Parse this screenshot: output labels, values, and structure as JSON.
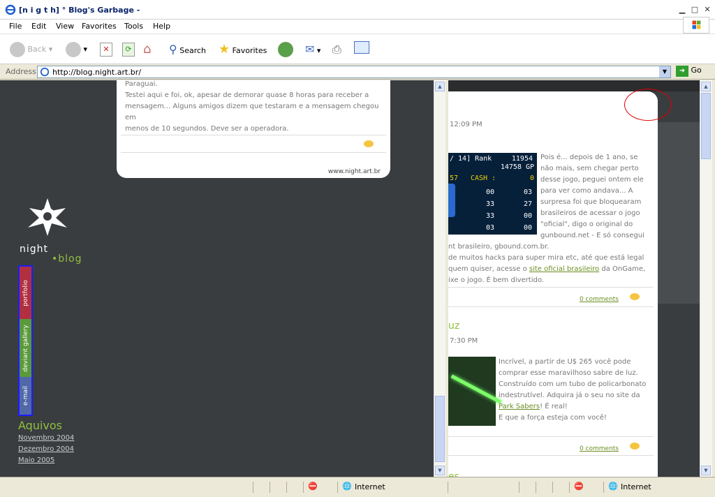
{
  "window": {
    "title": "[n i g t h] ° Blog's Garbage -"
  },
  "menu": [
    "File",
    "Edit",
    "View",
    "Favorites",
    "Tools",
    "Help"
  ],
  "toolbar": {
    "back": "Back",
    "search": "Search",
    "favorites": "Favorites"
  },
  "address": {
    "label": "Address",
    "url": "http://blog.night.art.br/",
    "go": "Go"
  },
  "left": {
    "post_text": [
      "Paraguai.",
      "Testei aqui e foi, ok, apesar de demorar quase 8 horas para receber a",
      "mensagem... Alguns amigos dizem que testaram e a mensagem chegou em",
      "menos de 10 segundos. Deve ser a operadora."
    ],
    "footer_url": "www.night.art.br",
    "logo_top": "night",
    "logo_bottom": "blog",
    "nav": [
      "portfolio",
      "deviant gallery",
      "e-mail"
    ],
    "archives_title": "Aquivos",
    "archives": [
      "Novembro 2004",
      "Dezembro 2004",
      "Maio 2005"
    ]
  },
  "right": {
    "post1_time": "12:09 PM",
    "game": {
      "rank_label": "/ 14]  Rank",
      "rank": "11954",
      "gp": "14758 GP",
      "cash_prefix": "57",
      "cash_label": "CASH :",
      "cash": "0",
      "stats": [
        "00",
        "03",
        "33",
        "27",
        "33",
        "00",
        "03",
        "00"
      ]
    },
    "post1_lines": [
      "Pois é... depois de 1 ano, se",
      "não mais, sem chegar perto",
      "desse jogo, peguei ontem ele",
      "para ver como andava... A",
      "surpresa foi que bloquearam",
      "brasileiros de acessar o jogo",
      "\"oficial\", digo o original do",
      "gunbound.net - E só consegui",
      "nt brasileiro, gbound.com.br.",
      "de muitos hacks para super mira etc, até que está legal",
      "quem quiser, acesse o "
    ],
    "post1_link": "site oficial brasileiro",
    "post1_after": " da OnGame,",
    "post1_last": "ixe o jogo. É bem divertido.",
    "comments1": "0 comments",
    "post2_title": "uz",
    "post2_time": "7:30 PM",
    "post2_lines": [
      "Incrível, a partir de U$ 265 você pode",
      "comprar esse maravilhoso sabre de luz.",
      "Construído com um tubo de policarbonato",
      "indestrutível. Adquira já o seu no site da"
    ],
    "post2_link": "Park Sabers",
    "post2_after": "! É real!",
    "post2_last": "E que a força esteja com você!",
    "comments2": "0 comments",
    "post3_title": "es"
  },
  "status": {
    "zone_left": "Internet",
    "zone_right": "Internet"
  }
}
